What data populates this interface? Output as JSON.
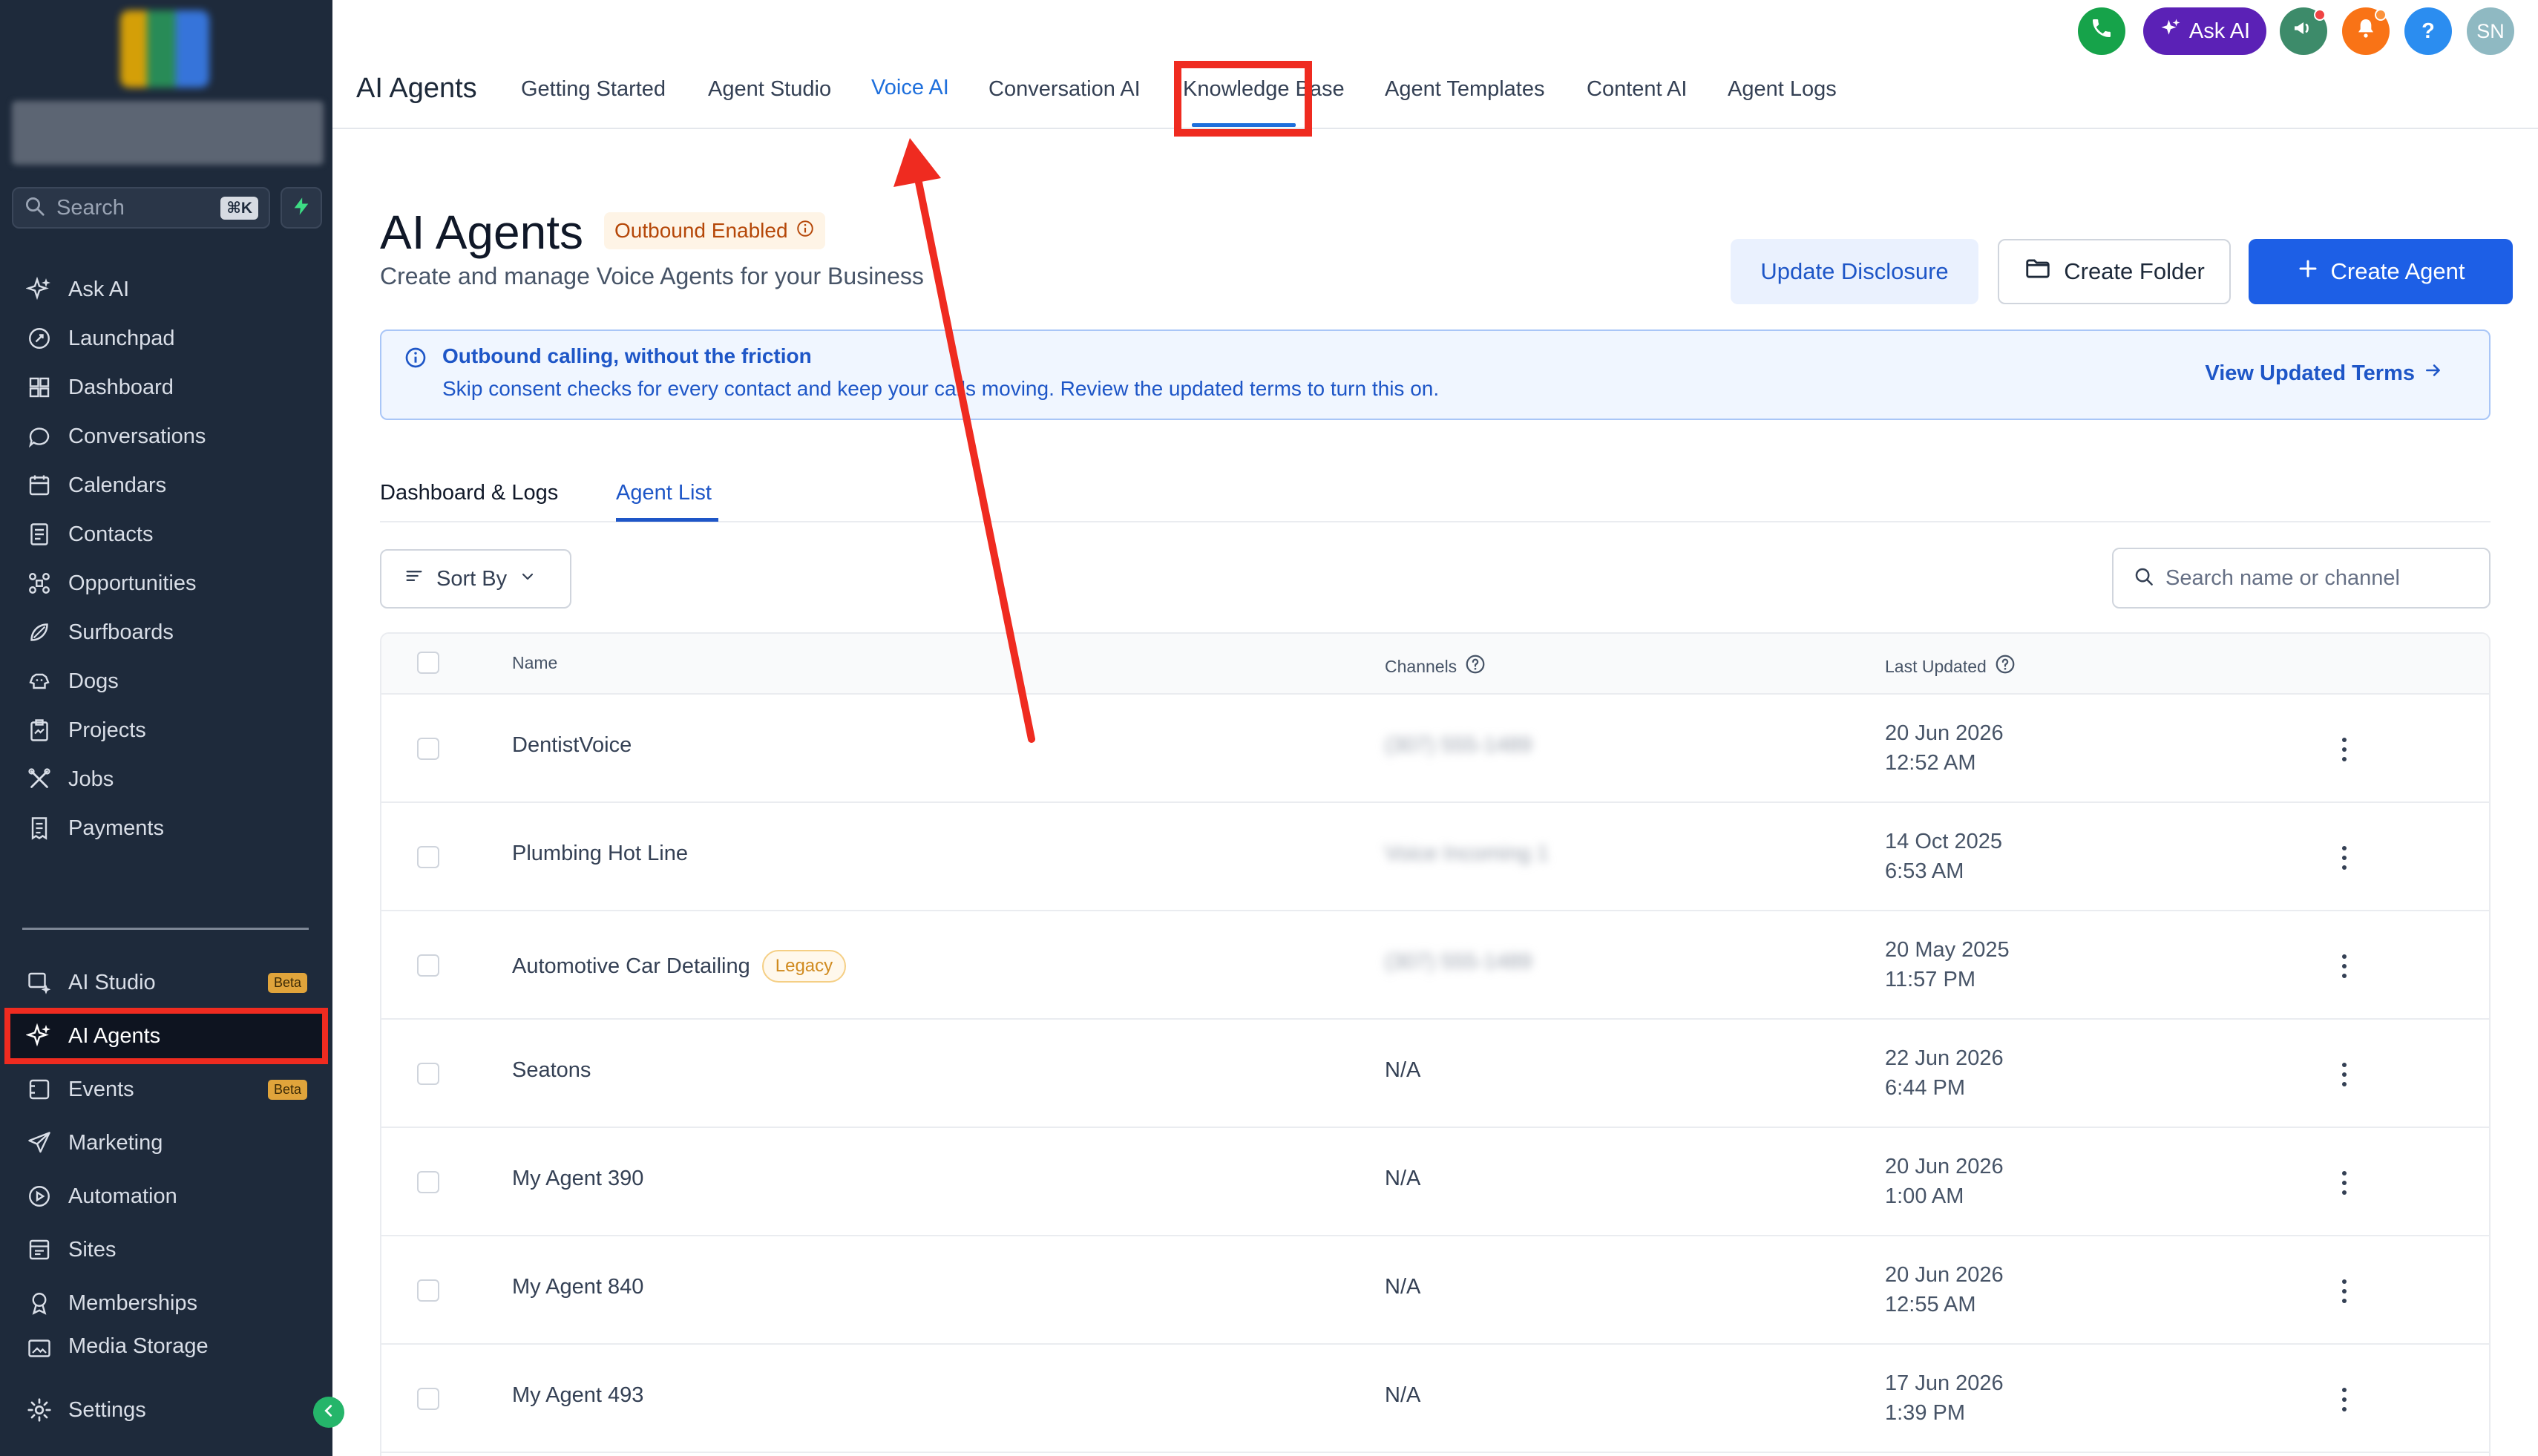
{
  "sidebar": {
    "search_label": "Search",
    "search_shortcut": "⌘K",
    "items": [
      {
        "label": "Ask AI",
        "icon": "sparkle-icon"
      },
      {
        "label": "Launchpad",
        "icon": "rocket-icon"
      },
      {
        "label": "Dashboard",
        "icon": "grid-icon"
      },
      {
        "label": "Conversations",
        "icon": "chat-icon"
      },
      {
        "label": "Calendars",
        "icon": "calendar-icon"
      },
      {
        "label": "Contacts",
        "icon": "contact-card-icon"
      },
      {
        "label": "Opportunities",
        "icon": "pipeline-icon"
      },
      {
        "label": "Surfboards",
        "icon": "surfboard-icon"
      },
      {
        "label": "Dogs",
        "icon": "dog-icon"
      },
      {
        "label": "Projects",
        "icon": "clipboard-icon"
      },
      {
        "label": "Jobs",
        "icon": "tools-icon"
      },
      {
        "label": "Payments",
        "icon": "invoice-icon"
      }
    ],
    "items2": [
      {
        "label": "AI Studio",
        "icon": "ai-studio-icon",
        "badge": "Beta"
      },
      {
        "label": "AI Agents",
        "icon": "sparkle-icon",
        "active": true
      },
      {
        "label": "Events",
        "icon": "events-icon",
        "badge": "Beta"
      },
      {
        "label": "Marketing",
        "icon": "send-icon"
      },
      {
        "label": "Automation",
        "icon": "automation-icon"
      },
      {
        "label": "Sites",
        "icon": "sites-icon"
      },
      {
        "label": "Memberships",
        "icon": "award-icon"
      },
      {
        "label": "Media Storage",
        "icon": "media-icon"
      }
    ],
    "settings_label": "Settings"
  },
  "topbar": {
    "app_title": "AI Agents",
    "tabs": [
      "Getting Started",
      "Agent Studio",
      "Voice AI",
      "Conversation AI",
      "Knowledge Base",
      "Agent Templates",
      "Content AI",
      "Agent Logs"
    ],
    "active_tab": "Voice AI",
    "ask_ai_label": "Ask AI",
    "help_label": "?",
    "avatar_initials": "SN"
  },
  "page": {
    "title": "AI Agents",
    "badge": "Outbound Enabled",
    "subtitle": "Create and manage Voice Agents for your Business",
    "btn_update": "Update Disclosure",
    "btn_folder": "Create Folder",
    "btn_create": "Create Agent"
  },
  "banner": {
    "title": "Outbound calling, without the friction",
    "text": "Skip consent checks for every contact and keep your calls moving. Review the updated terms to turn this on.",
    "link": "View Updated Terms"
  },
  "subtabs": {
    "dashboard": "Dashboard & Logs",
    "agent_list": "Agent List"
  },
  "toolbar": {
    "sort_label": "Sort By",
    "search_placeholder": "Search name or channel"
  },
  "table": {
    "headers": {
      "name": "Name",
      "channels": "Channels",
      "last_updated": "Last Updated"
    },
    "rows": [
      {
        "name": "DentistVoice",
        "channel": "(307) 555-1489",
        "date": "20 Jun 2026",
        "time": "12:52 AM",
        "legacy": ""
      },
      {
        "name": "Plumbing Hot Line",
        "channel": "Voice Incoming 1",
        "date": "14 Oct 2025",
        "time": "6:53 AM",
        "legacy": ""
      },
      {
        "name": "Automotive Car Detailing",
        "channel": "(307) 555-1489",
        "date": "20 May 2025",
        "time": "11:57 PM",
        "legacy": "Legacy"
      },
      {
        "name": "Seatons",
        "channel": "N/A",
        "date": "22 Jun 2026",
        "time": "6:44 PM",
        "legacy": ""
      },
      {
        "name": "My Agent 390",
        "channel": "N/A",
        "date": "20 Jun 2026",
        "time": "1:00 AM",
        "legacy": ""
      },
      {
        "name": "My Agent 840",
        "channel": "N/A",
        "date": "20 Jun 2026",
        "time": "12:55 AM",
        "legacy": ""
      },
      {
        "name": "My Agent 493",
        "channel": "N/A",
        "date": "17 Jun 2026",
        "time": "1:39 PM",
        "legacy": ""
      }
    ]
  },
  "colors": {
    "sidebar_bg": "#1e2a3b",
    "accent_blue": "#1d5fe6",
    "annotation_red": "#ef2b20",
    "ask_ai_purple": "#5b21b6"
  }
}
